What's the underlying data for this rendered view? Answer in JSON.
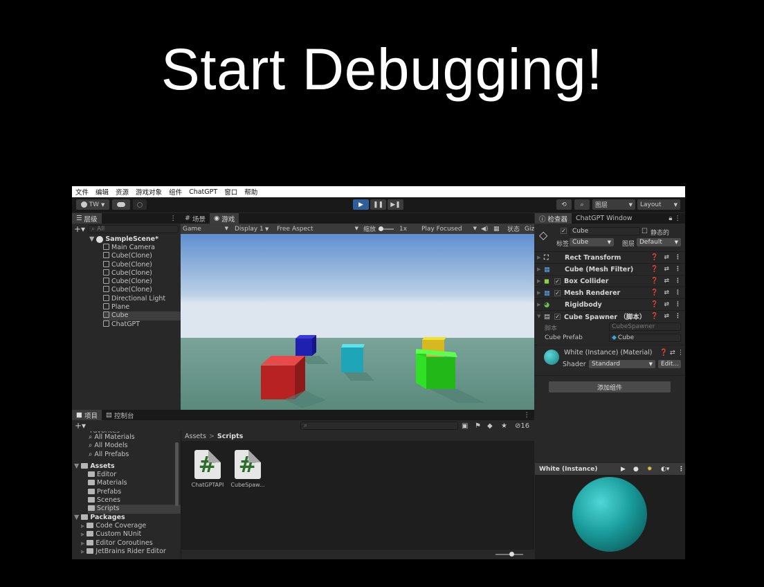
{
  "slide": {
    "title": "Start Debugging!"
  },
  "menu": [
    "文件",
    "编辑",
    "资源",
    "游戏对象",
    "组件",
    "ChatGPT",
    "窗口",
    "帮助"
  ],
  "toolbar": {
    "account": "TW",
    "layers": "图层",
    "layout": "Layout"
  },
  "hierarchy": {
    "tab": "层级",
    "search_placeholder": "All",
    "scene": "SampleScene*",
    "items": [
      "Main Camera",
      "Cube(Clone)",
      "Cube(Clone)",
      "Cube(Clone)",
      "Cube(Clone)",
      "Cube(Clone)",
      "Directional Light",
      "Plane",
      "Cube",
      "ChatGPT"
    ]
  },
  "game": {
    "tab_scene": "场景",
    "tab_game": "游戏",
    "mode": "Game",
    "display": "Display 1",
    "aspect": "Free Aspect",
    "scale_label": "缩放",
    "scale_value": "1x",
    "play_focused": "Play Focused",
    "stats": "状态",
    "gizmos": "Giz"
  },
  "inspector": {
    "tab_inspector": "检查器",
    "tab_chatgpt": "ChatGPT Window",
    "object_name": "Cube",
    "static_label": "静态的",
    "tag_label": "标签",
    "tag_value": "Cube",
    "layer_label": "图层",
    "layer_value": "Default",
    "components": [
      "Rect Transform",
      "Cube (Mesh Filter)",
      "Box Collider",
      "Mesh Renderer",
      "Rigidbody",
      "Cube Spawner （脚本）"
    ],
    "script_label": "脚本",
    "script_value": "CubeSpawner",
    "prefab_label": "Cube Prefab",
    "prefab_value": "Cube",
    "material_name": "White (Instance) (Material)",
    "shader_label": "Shader",
    "shader_value": "Standard",
    "edit_label": "Edit...",
    "add_component": "添加组件",
    "preview_title": "White (Instance)"
  },
  "project": {
    "tab_project": "项目",
    "tab_console": "控制台",
    "hidden_count": "16",
    "favorites_partial": "Favorites",
    "favorites": [
      "All Materials",
      "All Models",
      "All Prefabs"
    ],
    "assets_root": "Assets",
    "asset_folders": [
      "Editor",
      "Materials",
      "Prefabs",
      "Scenes",
      "Scripts"
    ],
    "packages_root": "Packages",
    "package_folders": [
      "Code Coverage",
      "Custom NUnit",
      "Editor Coroutines",
      "JetBrains Rider Editor"
    ],
    "breadcrumb_root": "Assets",
    "breadcrumb_sep": ">",
    "breadcrumb_current": "Scripts",
    "files": [
      "ChatGPTAPI",
      "CubeSpaw..."
    ]
  },
  "colors": {
    "sky_top": "#5f8fd0",
    "ground": "#5f8f80",
    "accent_play": "#2f5f9a",
    "sphere": "#20a0a0"
  }
}
